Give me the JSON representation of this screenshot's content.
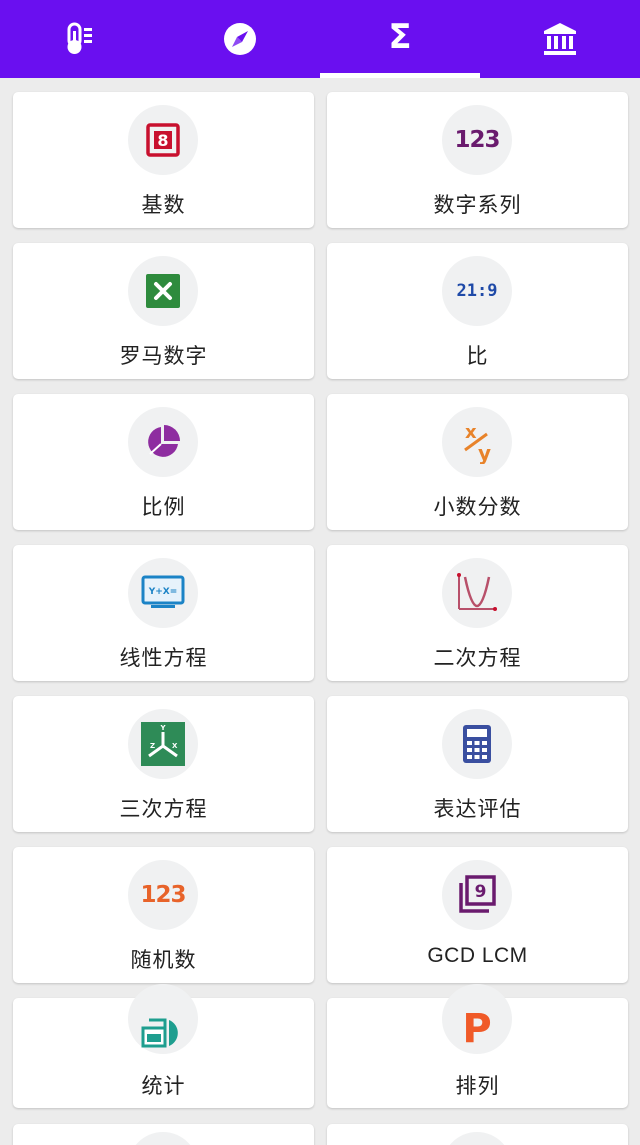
{
  "topbar": {
    "background": "#6a0ff0",
    "tabs": [
      {
        "icon": "thermometer-icon",
        "selected": false
      },
      {
        "icon": "compass-icon",
        "selected": false
      },
      {
        "icon": "sigma-icon",
        "glyph": "Σ",
        "selected": true
      },
      {
        "icon": "bank-icon",
        "selected": false
      }
    ]
  },
  "calculators": [
    {
      "label": "基数",
      "icon": "number-8-icon",
      "icon_text": "8"
    },
    {
      "label": "数字系列",
      "icon": "number-123-icon",
      "icon_text": "123"
    },
    {
      "label": "罗马数字",
      "icon": "x-box-icon"
    },
    {
      "label": "比",
      "icon": "ratio-icon",
      "icon_text": "21:9"
    },
    {
      "label": "比例",
      "icon": "pie-chart-icon"
    },
    {
      "label": "小数分数",
      "icon": "fraction-icon",
      "icon_text_top": "x",
      "icon_text_bottom": "y"
    },
    {
      "label": "线性方程",
      "icon": "linear-equation-icon",
      "icon_text": "Y+X="
    },
    {
      "label": "二次方程",
      "icon": "parabola-icon"
    },
    {
      "label": "三次方程",
      "icon": "cubic-equation-icon"
    },
    {
      "label": "表达评估",
      "icon": "calculator-icon"
    },
    {
      "label": "随机数",
      "icon": "random-123-icon",
      "icon_text": "123"
    },
    {
      "label": "GCD LCM",
      "icon": "gcd-lcm-icon",
      "icon_text": "9"
    },
    {
      "label": "统计",
      "icon": "statistics-icon"
    },
    {
      "label": "排列",
      "icon": "permutation-icon",
      "icon_text": "P"
    }
  ]
}
